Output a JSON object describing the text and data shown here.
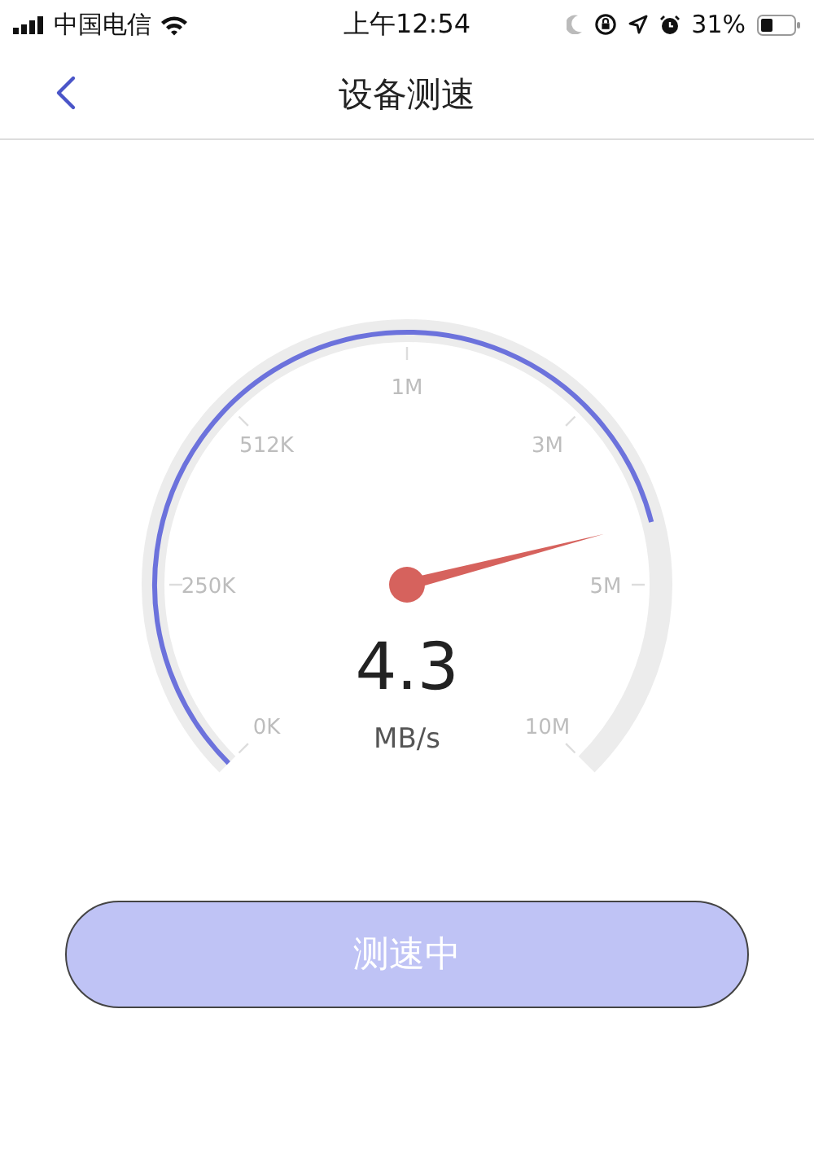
{
  "status_bar": {
    "carrier": "中国电信",
    "time": "上午12:54",
    "battery": "31%"
  },
  "nav": {
    "title": "设备测速"
  },
  "gauge": {
    "value": "4.3",
    "unit": "MB/s",
    "ticks": [
      "0K",
      "250K",
      "512K",
      "1M",
      "3M",
      "5M",
      "10M"
    ]
  },
  "button": {
    "label": "测速中"
  }
}
